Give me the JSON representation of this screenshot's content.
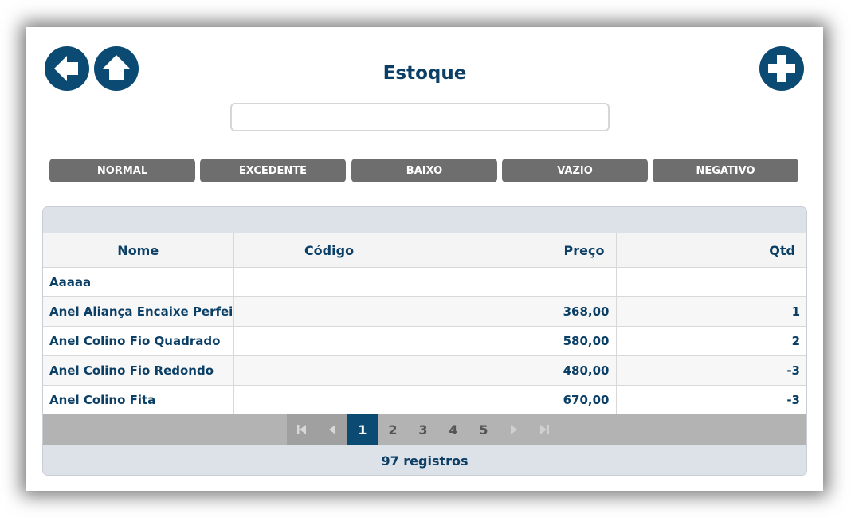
{
  "header": {
    "title": "Estoque",
    "back_icon": "arrow-left-icon",
    "home_icon": "arrow-up-icon",
    "add_icon": "plus-icon"
  },
  "search": {
    "value": "",
    "placeholder": ""
  },
  "filters": [
    "NORMAL",
    "EXCEDENTE",
    "BAIXO",
    "VAZIO",
    "NEGATIVO"
  ],
  "table": {
    "columns": [
      "Nome",
      "Código",
      "Preço",
      "Qtd"
    ],
    "rows": [
      [
        "Aaaaa",
        "",
        "",
        ""
      ],
      [
        "Anel Aliança Encaixe Perfeito",
        "",
        "368,00",
        "1"
      ],
      [
        "Anel Colino Fio Quadrado",
        "",
        "580,00",
        "2"
      ],
      [
        "Anel Colino Fio Redondo",
        "",
        "480,00",
        "-3"
      ],
      [
        "Anel Colino Fita",
        "",
        "670,00",
        "-3"
      ]
    ]
  },
  "pager": {
    "pages": [
      "1",
      "2",
      "3",
      "4",
      "5"
    ],
    "current": "1"
  },
  "footer": {
    "count_text": "97 registros"
  },
  "colors": {
    "accent": "#0b4a72",
    "filter_bg": "#6e6e6e",
    "text": "#0b3f66"
  }
}
